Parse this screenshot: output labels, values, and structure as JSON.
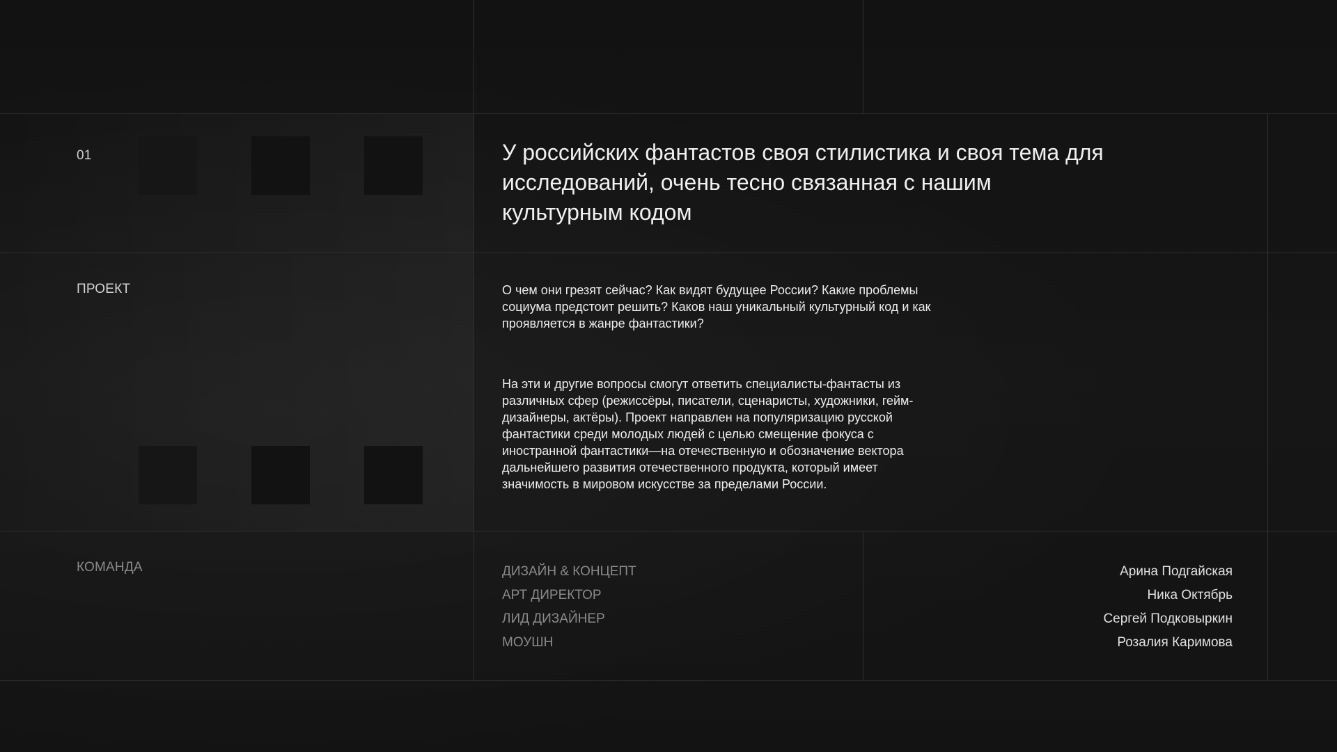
{
  "section": {
    "number": "01",
    "project_label": "ПРОЕКТ",
    "team_label": "КОМАНДА"
  },
  "quote": "У российских фантастов своя стилистика и своя тема для исследований, очень тесно связанная с нашим культурным кодом",
  "paragraphs": [
    "О чем они грезят сейчас? Как видят будущее России? Какие проблемы социума предстоит решить? Каков наш уникальный культурный код и как проявляется в жанре фантастики?",
    "На эти и другие вопросы смогут ответить специалисты-фантасты из различных сфер (режиссёры, писатели, сценаристы, художники, гейм-дизайнеры, актёры). Проект направлен на популяризацию русской фантастики среди молодых людей с целью смещение фокуса с иностранной фантастики—на отечественную и обозначение вектора дальнейшего развития отечественного продукта, который имеет значимость в мировом искусстве за пределами России."
  ],
  "team": {
    "roles": [
      "ДИЗАЙН & КОНЦЕПТ",
      "АРТ ДИРЕКТОР",
      "ЛИД ДИЗАЙНЕР",
      "МОУШН"
    ],
    "names": [
      "Арина Подгайская",
      "Ника Октябрь",
      "Сергей Подковыркин",
      "Розалия Каримова"
    ]
  },
  "colors": {
    "background": "#141414",
    "grid_line": "#2f2f2f",
    "text_primary": "#ededed",
    "text_muted": "#8a8a8a"
  }
}
